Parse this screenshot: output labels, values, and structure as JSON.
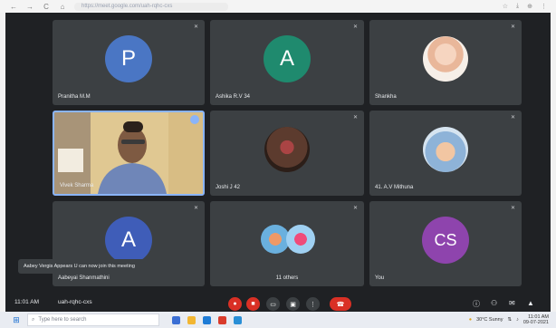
{
  "browser": {
    "url": "https://meet.google.com/uah-rqhc-cxs",
    "nav": [
      "←",
      "→",
      "C",
      "⌂"
    ],
    "icons": [
      "☆",
      "⤓",
      "⊕",
      "⋮"
    ]
  },
  "tiles": [
    {
      "name": "Pranitha M.M",
      "initial": "P",
      "color": "#4a76c4",
      "kind": "letter"
    },
    {
      "name": "Ashika R.V 34",
      "initial": "A",
      "color": "#1f8a6e",
      "kind": "letter"
    },
    {
      "name": "Shankha",
      "initial": "",
      "color": "#f3e4d3",
      "kind": "photo-girl"
    },
    {
      "name": "Vivek Sharma",
      "initial": "",
      "color": "",
      "kind": "video"
    },
    {
      "name": "Joshi J 42",
      "initial": "",
      "color": "#7a5a4a",
      "kind": "photo-dark"
    },
    {
      "name": "41. A.V Mithuna",
      "initial": "",
      "color": "#b8c5d4",
      "kind": "photo-baby"
    },
    {
      "name": "Aabeyai Shanmathini",
      "initial": "A",
      "color": "#3f5db8",
      "kind": "letter"
    },
    {
      "name": "11 others",
      "initial": "",
      "color": "",
      "kind": "group"
    },
    {
      "name": "You",
      "initial": "CS",
      "color": "#8e44ad",
      "kind": "letter"
    }
  ],
  "toast": "Aabey Vergis Appears U can now join this meeting",
  "bottom": {
    "time": "11:01 AM",
    "code": "uah-rqhc-cxs",
    "hangup_icon": "phone-hangup-icon"
  },
  "taskbar": {
    "search_placeholder": "Type here to search",
    "weather": "30°C  Sunny",
    "time": "11:01 AM",
    "date": "09-07-2021"
  }
}
